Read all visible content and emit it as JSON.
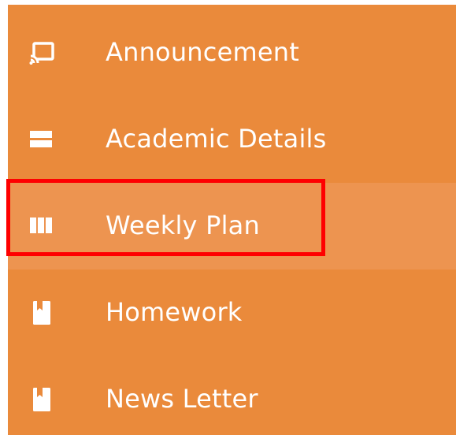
{
  "sidebar": {
    "items": [
      {
        "label": "Announcement",
        "icon": "cast-icon"
      },
      {
        "label": "Academic Details",
        "icon": "card-icon"
      },
      {
        "label": "Weekly Plan",
        "icon": "columns-icon",
        "active": true
      },
      {
        "label": "Homework",
        "icon": "book-icon"
      },
      {
        "label": "News Letter",
        "icon": "book-icon"
      }
    ]
  },
  "colors": {
    "sidebar_bg": "#ea8a3b",
    "active_bg": "#ed9450",
    "text": "#ffffff",
    "highlight": "#ff0000"
  }
}
